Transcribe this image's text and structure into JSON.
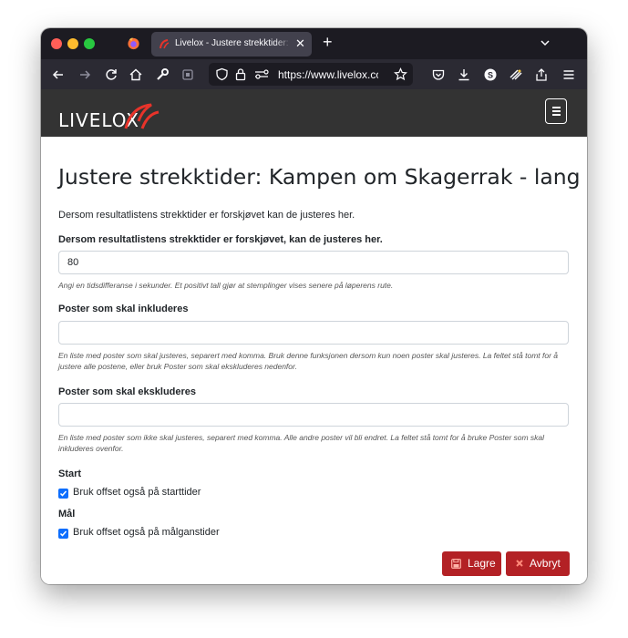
{
  "browser": {
    "tab_title": "Livelox - Justere strekktider: Kampen om Skagerrak - lang",
    "url": "https://www.livelox.com/"
  },
  "site": {
    "logo": "LIVELOX"
  },
  "page": {
    "title": "Justere strekktider: Kampen om Skagerrak - lang",
    "intro": "Dersom resultatlistens strekktider er forskjøvet kan de justeres her.",
    "offset_label": "Dersom resultatlistens strekktider er forskjøvet, kan de justeres her.",
    "offset_value": "80",
    "offset_help": "Angi en tidsdifferanse i sekunder. Et positivt tall gjør at stemplinger vises senere på løperens rute.",
    "include_label": "Poster som skal inkluderes",
    "include_value": "",
    "include_help": "En liste med poster som skal justeres, separert med komma. Bruk denne funksjonen dersom kun noen poster skal justeres. La feltet stå tomt for å justere alle postene, eller bruk Poster som skal ekskluderes nedenfor.",
    "exclude_label": "Poster som skal ekskluderes",
    "exclude_value": "",
    "exclude_help": "En liste med poster som ikke skal justeres, separert med komma. Alle andre poster vil bli endret. La feltet stå tomt for å bruke Poster som skal inkluderes ovenfor.",
    "start_heading": "Start",
    "start_checkbox": "Bruk offset også på starttider",
    "finish_heading": "Mål",
    "finish_checkbox": "Bruk offset også på målganstider",
    "save_button": "Lagre",
    "cancel_button": "Avbryt"
  },
  "colors": {
    "primary_button": "#b32125",
    "header_bg": "#333333",
    "checkbox": "#0d6efd"
  }
}
